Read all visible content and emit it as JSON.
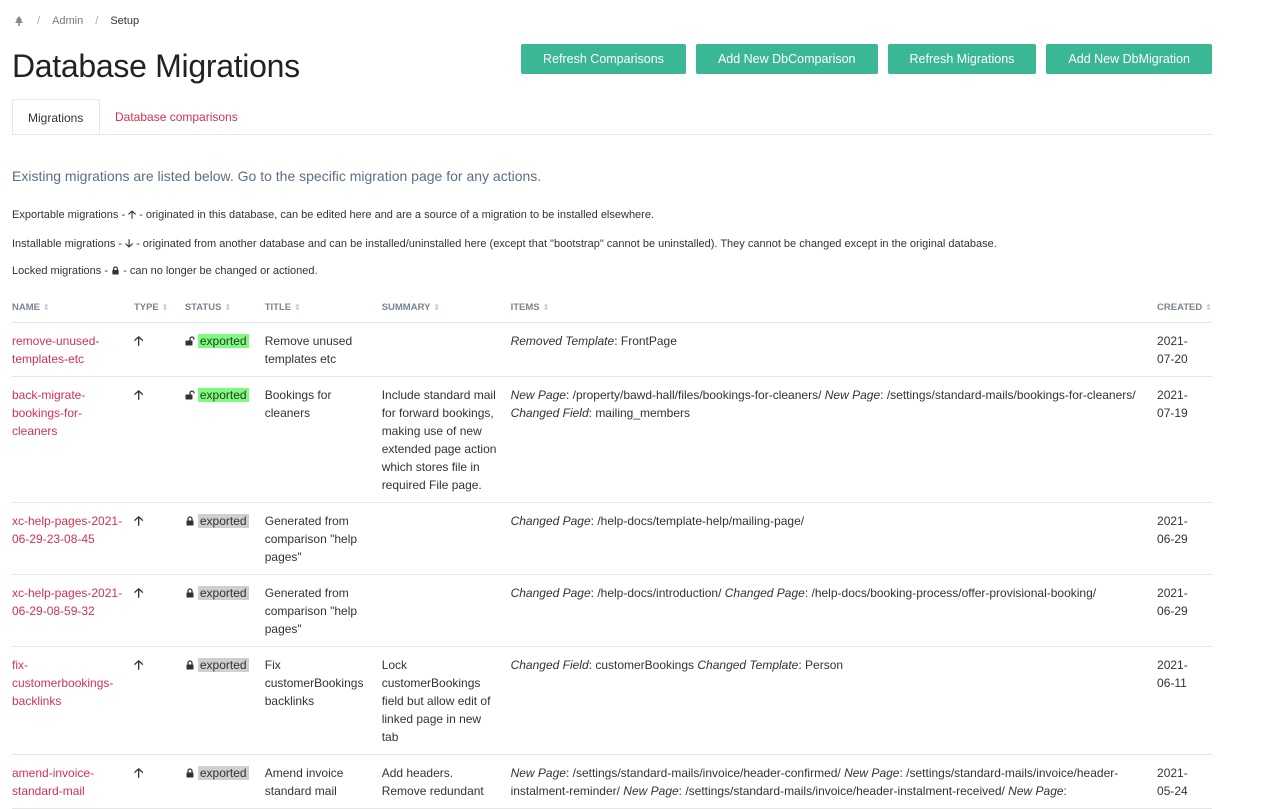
{
  "breadcrumb": {
    "items": [
      "Admin",
      "Setup"
    ]
  },
  "page_title": "Database Migrations",
  "buttons": [
    "Refresh Comparisons",
    "Add New DbComparison",
    "Refresh Migrations",
    "Add New DbMigration"
  ],
  "tabs": [
    "Migrations",
    "Database comparisons"
  ],
  "intro": {
    "lead": "Existing migrations are listed below. Go to the specific migration page for any actions.",
    "exportable": {
      "label": "Exportable migrations - ",
      "arrow": "🡡",
      "text": " - originated in this database, can be edited here and are a source of a migration to be installed elsewhere."
    },
    "installable": {
      "label": "Installable migrations - ",
      "arrow": "🡣",
      "text": " - originated from another database and can be installed/uninstalled here (except that \"bootstrap\" cannot be uninstalled). They cannot be changed except in the original database."
    },
    "locked": {
      "label": "Locked migrations - ",
      "text": " - can no longer be changed or actioned."
    }
  },
  "table": {
    "headers": [
      "NAME",
      "TYPE",
      "STATUS",
      "TITLE",
      "SUMMARY",
      "ITEMS",
      "CREATED"
    ],
    "sort_icon": "⇕",
    "rows": [
      {
        "name": "remove-unused-templates-etc",
        "type": "🡡",
        "locked": false,
        "status": "exported",
        "title": "Remove unused templates etc",
        "summary": "",
        "items": [
          {
            "label": "Removed Template",
            "value": "FrontPage"
          }
        ],
        "created": "2021-07-20"
      },
      {
        "name": "back-migrate-bookings-for-cleaners",
        "type": "🡡",
        "locked": false,
        "status": "exported",
        "title": "Bookings for cleaners",
        "summary": "Include standard mail for forward bookings, making use of new extended page action which stores file in required File page.",
        "items": [
          {
            "label": "New Page",
            "value": "/property/bawd-hall/files/bookings-for-cleaners/"
          },
          {
            "label": "New Page",
            "value": "/settings/standard-mails/bookings-for-cleaners/"
          },
          {
            "label": "Changed Field",
            "value": "mailing_members"
          }
        ],
        "created": "2021-07-19"
      },
      {
        "name": "xc-help-pages-2021-06-29-23-08-45",
        "type": "🡡",
        "locked": true,
        "status": "exported",
        "title": "Generated from comparison \"help pages\"",
        "summary": "",
        "items": [
          {
            "label": "Changed Page",
            "value": "/help-docs/template-help/mailing-page/"
          }
        ],
        "created": "2021-06-29"
      },
      {
        "name": "xc-help-pages-2021-06-29-08-59-32",
        "type": "🡡",
        "locked": true,
        "status": "exported",
        "title": "Generated from comparison \"help pages\"",
        "summary": "",
        "items": [
          {
            "label": "Changed Page",
            "value": "/help-docs/introduction/"
          },
          {
            "label": "Changed Page",
            "value": "/help-docs/booking-process/offer-provisional-booking/"
          }
        ],
        "created": "2021-06-29"
      },
      {
        "name": "fix-customerbookings-backlinks",
        "type": "🡡",
        "locked": true,
        "status": "exported",
        "title": "Fix customerBookings backlinks",
        "summary": "Lock customerBookings field but allow edit of linked page in new tab",
        "items": [
          {
            "label": "Changed Field",
            "value": "customerBookings"
          },
          {
            "label": "Changed Template",
            "value": "Person"
          }
        ],
        "created": "2021-06-11"
      },
      {
        "name": "amend-invoice-standard-mail",
        "type": "🡡",
        "locked": true,
        "status": "exported",
        "title": "Amend invoice standard mail",
        "summary": "Add headers. Remove redundant",
        "items": [
          {
            "label": "New Page",
            "value": "/settings/standard-mails/invoice/header-confirmed/"
          },
          {
            "label": "New Page",
            "value": "/settings/standard-mails/invoice/header-instalment-reminder/"
          },
          {
            "label": "New Page",
            "value": "/settings/standard-mails/invoice/header-instalment-received/"
          },
          {
            "label": "New Page",
            "value": ""
          }
        ],
        "created": "2021-05-24"
      }
    ]
  },
  "colors": {
    "button": "#3ab795",
    "link": "#d0334f",
    "exported_unlocked": "#7cfc7c",
    "exported_locked": "#cfcfcf",
    "lead": "#5b6f86"
  }
}
